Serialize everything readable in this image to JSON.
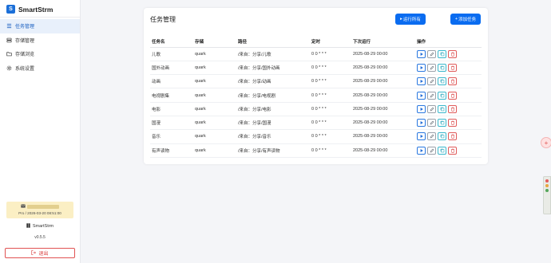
{
  "app": {
    "name": "SmartStrm",
    "version": "v0.5.5",
    "logo_letter": "S"
  },
  "sidebar": {
    "items": [
      {
        "label": "任务管理",
        "icon": "list-icon",
        "active": true
      },
      {
        "label": "存储管理",
        "icon": "database-icon",
        "active": false
      },
      {
        "label": "存储浏览",
        "icon": "folder-icon",
        "active": false
      },
      {
        "label": "系统设置",
        "icon": "gear-icon",
        "active": false
      }
    ],
    "license_line": "Pro / 2026-03-20 08:51:00",
    "app_label": "SmartStrm",
    "version": "v0.5.5",
    "logout_label": "退出"
  },
  "main": {
    "title": "任务管理",
    "run_all_label": "运行所有",
    "add_label": "添加任务",
    "columns": [
      "任务名",
      "存储",
      "路径",
      "定时",
      "下次运行",
      "操作"
    ],
    "rows": [
      {
        "name": "儿歌",
        "storage": "quark",
        "path": "/来自：分享/儿歌",
        "schedule": "0 0 * * *",
        "next_run": "2025-08-29 00:00"
      },
      {
        "name": "国外动画",
        "storage": "quark",
        "path": "/来自：分享/国外动画",
        "schedule": "0 0 * * *",
        "next_run": "2025-08-29 00:00"
      },
      {
        "name": "动画",
        "storage": "quark",
        "path": "/来自：分享/动画",
        "schedule": "0 0 * * *",
        "next_run": "2025-08-29 00:00"
      },
      {
        "name": "电视剧集",
        "storage": "quark",
        "path": "/来自：分享/电视剧",
        "schedule": "0 0 * * *",
        "next_run": "2025-08-29 00:00"
      },
      {
        "name": "电影",
        "storage": "quark",
        "path": "/来自：分享/电影",
        "schedule": "0 0 * * *",
        "next_run": "2025-08-29 00:00"
      },
      {
        "name": "国漫",
        "storage": "quark",
        "path": "/来自：分享/国漫",
        "schedule": "0 0 * * *",
        "next_run": "2025-08-29 00:00"
      },
      {
        "name": "音乐",
        "storage": "quark",
        "path": "/来自：分享/音乐",
        "schedule": "0 0 * * *",
        "next_run": "2025-08-29 00:00"
      },
      {
        "name": "有声读物",
        "storage": "quark",
        "path": "/来自：分享/有声读物",
        "schedule": "0 0 * * *",
        "next_run": "2025-08-29 00:00"
      }
    ]
  },
  "colors": {
    "primary": "#0a6cf0",
    "danger": "#e05252",
    "license_bg": "#fbefc4",
    "active_nav_bg": "#e8f0fb"
  }
}
